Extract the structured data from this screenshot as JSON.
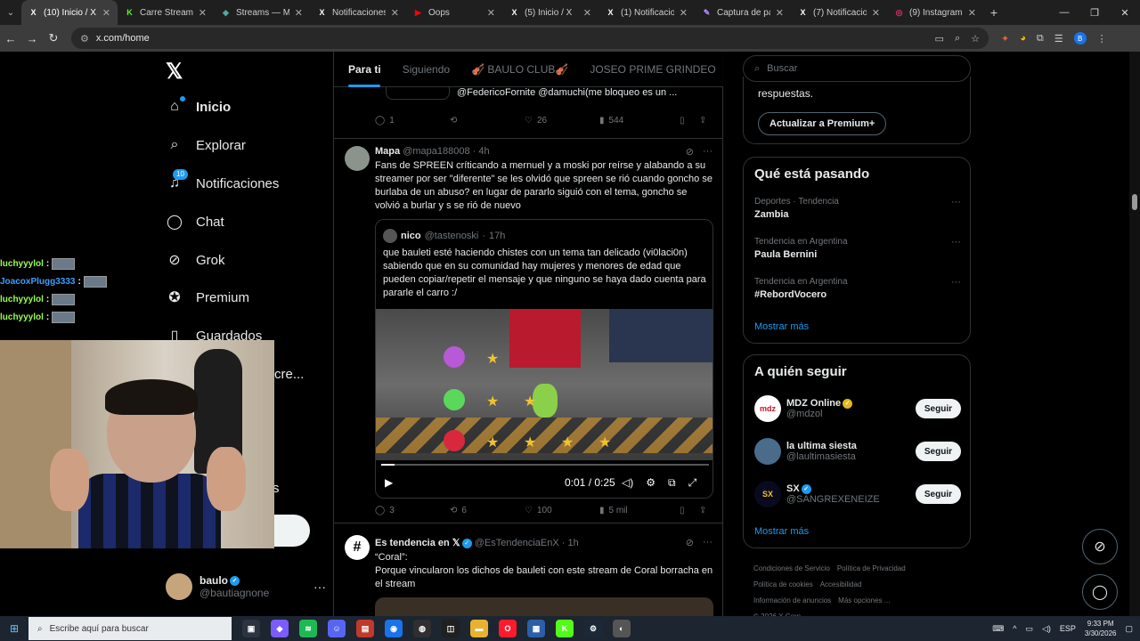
{
  "browser": {
    "tabs": [
      {
        "title": "(10) Inicio / X",
        "icon": "X",
        "color": "#ffffff",
        "active": true
      },
      {
        "title": "Carre Stream - W",
        "icon": "K",
        "color": "#53fc18",
        "active": false
      },
      {
        "title": "Streams — MCSR",
        "icon": "◈",
        "color": "#4fb3a9",
        "active": false
      },
      {
        "title": "Notificaciones / X",
        "icon": "X",
        "color": "#ffffff",
        "active": false
      },
      {
        "title": "Oops",
        "icon": "▶",
        "color": "#ff0000",
        "active": false
      },
      {
        "title": "(5) Inicio / X",
        "icon": "X",
        "color": "#ffffff",
        "active": false
      },
      {
        "title": "(1) Notificaciones",
        "icon": "X",
        "color": "#ffffff",
        "active": false
      },
      {
        "title": "Captura de pantal",
        "icon": "✎",
        "color": "#b48cff",
        "active": false
      },
      {
        "title": "(7) Notificaciones",
        "icon": "X",
        "color": "#ffffff",
        "active": false
      },
      {
        "title": "(9) Instagram",
        "icon": "◎",
        "color": "#e1306c",
        "active": false
      }
    ],
    "url": "x.com/home",
    "profile_initial": "B"
  },
  "sidebar": {
    "items": [
      {
        "label": "Inicio",
        "icon": "home-icon",
        "glyph": "⌂",
        "bold": true
      },
      {
        "label": "Explorar",
        "icon": "search-icon",
        "glyph": "⌕",
        "bold": false
      },
      {
        "label": "Notificaciones",
        "icon": "bell-icon",
        "glyph": "♫",
        "bold": false,
        "badge": "10"
      },
      {
        "label": "Chat",
        "icon": "chat-icon",
        "glyph": "◯",
        "bold": false
      },
      {
        "label": "Grok",
        "icon": "grok-icon",
        "glyph": "⊘",
        "bold": false
      },
      {
        "label": "Premium",
        "icon": "premium-icon",
        "glyph": "✪",
        "bold": false
      },
      {
        "label": "Guardados",
        "icon": "bookmark-icon",
        "glyph": "▯",
        "bold": false
      }
    ],
    "partial_text": "cre...",
    "partial_s": "s",
    "profile": {
      "name": "baulo",
      "handle": "@bautiagnone"
    }
  },
  "stream_chat": [
    {
      "user": "luchyyylol",
      "color": "#9aff50"
    },
    {
      "user": "JoacoxPlugg3333",
      "color": "#3aa0ff"
    },
    {
      "user": "luchyyylol",
      "color": "#9aff50"
    },
    {
      "user": "luchyyylol",
      "color": "#9aff50"
    }
  ],
  "timeline": {
    "tabs": [
      "Para ti",
      "Siguiendo",
      "🎻 BAULO CLUB🎻",
      "JOSEO PRIME GRINDEO"
    ],
    "prev_post": {
      "text": "@FedericoFornite @damuchi(me bloqueo es un ...",
      "replies": "1",
      "reposts": "",
      "likes": "26",
      "views": "544"
    },
    "post1": {
      "name": "Mapa",
      "handle": "@mapa188008",
      "time": "4h",
      "text": "Fans de SPREEN críticando a mernuel y a moski por reírse y alabando a su streamer por ser \"diferente\" se les olvidó que spreen se rió cuando goncho se burlaba de un abuso? en lugar de pararlo siguió con el tema, goncho se volvió a burlar y s se rió de nuevo",
      "quote": {
        "name": "nico",
        "handle": "@tastenoski",
        "time": "17h",
        "text": "que bauleti esté haciendo chistes con un tema tan delicado (vi0laci0n) sabiendo que en su comunidad hay mujeres y menores de edad que pueden copiar/repetir el mensaje y que ninguno se haya dado cuenta para pararle el carro :/"
      },
      "video_time": "0:01 / 0:25",
      "video_progress": 0.04,
      "replies": "3",
      "reposts": "6",
      "likes": "100",
      "views": "5 mil"
    },
    "post2": {
      "name": "Es tendencia en 𝕏",
      "handle": "@EsTendenciaEnX",
      "time": "1h",
      "text": "“Coral”:\nPorque vincularon los dichos de bauleti con este stream de Coral borracha en el stream"
    }
  },
  "right": {
    "search_placeholder": "Buscar",
    "premium_text": "respuestas.",
    "premium_button": "Actualizar a Premium+",
    "trends_title": "Qué está pasando",
    "trends": [
      {
        "context": "Deportes · Tendencia",
        "name": "Zambia"
      },
      {
        "context": "Tendencia en Argentina",
        "name": "Paula Bernini"
      },
      {
        "context": "Tendencia en Argentina",
        "name": "#RebordVocero"
      }
    ],
    "show_more": "Mostrar más",
    "follow_title": "A quién seguir",
    "follow": [
      {
        "name": "MDZ Online",
        "handle": "@mdzol",
        "badge": "gold",
        "avatar_text": "mdz",
        "avatar_bg": "#ffffff",
        "avatar_fg": "#c8102e"
      },
      {
        "name": "la ultima siesta",
        "handle": "@laultimasiesta",
        "badge": "",
        "avatar_text": "",
        "avatar_bg": "#4a6b8a",
        "avatar_fg": "#ffffff"
      },
      {
        "name": "SX",
        "handle": "@SANGREXENEIZE",
        "badge": "blue",
        "avatar_text": "SX",
        "avatar_bg": "#0a0a1e",
        "avatar_fg": "#f2c230"
      }
    ],
    "follow_button": "Seguir",
    "footer": [
      "Condiciones de Servicio",
      "Política de Privacidad",
      "Política de cookies",
      "Accesibilidad",
      "Información de anuncios",
      "Más opciones ...",
      "© 2026 X Corp."
    ]
  },
  "taskbar": {
    "search_placeholder": "Escribe aquí para buscar",
    "apps": [
      {
        "name": "task-view",
        "color": "#2b3440",
        "glyph": "▣"
      },
      {
        "name": "copilot",
        "color": "#7b5cff",
        "glyph": "◆"
      },
      {
        "name": "spotify",
        "color": "#1db954",
        "glyph": "≋"
      },
      {
        "name": "discord",
        "color": "#5865f2",
        "glyph": "☺"
      },
      {
        "name": "virtual-mixer",
        "color": "#c0392b",
        "glyph": "▤"
      },
      {
        "name": "chrome",
        "color": "#1a73e8",
        "glyph": "◉"
      },
      {
        "name": "obs",
        "color": "#302e31",
        "glyph": "◍"
      },
      {
        "name": "app-dark",
        "color": "#202020",
        "glyph": "◫"
      },
      {
        "name": "explorer",
        "color": "#e8b230",
        "glyph": "▬"
      },
      {
        "name": "opera",
        "color": "#ff1b2d",
        "glyph": "O"
      },
      {
        "name": "app-blue",
        "color": "#2d5fa8",
        "glyph": "▦"
      },
      {
        "name": "kick",
        "color": "#53fc18",
        "glyph": "K"
      },
      {
        "name": "steam",
        "color": "#1b2838",
        "glyph": "⚙"
      },
      {
        "name": "app-gray",
        "color": "#555555",
        "glyph": "◐"
      }
    ],
    "lang": "ESP",
    "time": "9:33 PM",
    "date": "3/30/2026"
  }
}
